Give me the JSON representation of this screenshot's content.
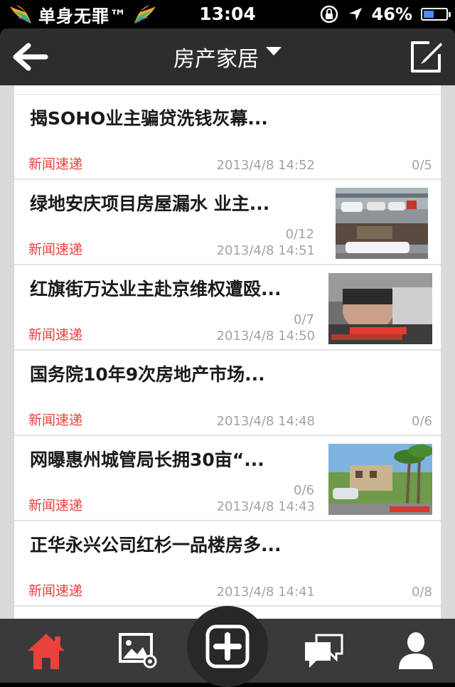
{
  "status_bar": {
    "carrier": "单身无罪™",
    "time": "13:04",
    "battery_percent": "46%",
    "battery_level": 0.46
  },
  "nav": {
    "title": "房产家居",
    "back_icon": "arrow-left-icon",
    "dropdown_icon": "triangle-down-icon",
    "compose_icon": "compose-icon"
  },
  "news": [
    {
      "title": "揭SOHO业主骗贷洗钱灰幕...",
      "category": "新闻速递",
      "time": "2013/4/8 14:52",
      "count": "0/5",
      "has_image": false
    },
    {
      "title": "绿地安庆项目房屋漏水 业主...",
      "category": "新闻速递",
      "time": "2013/4/8 14:51",
      "count": "0/12",
      "has_image": true
    },
    {
      "title": "红旗街万达业主赴京维权遭殴...",
      "category": "新闻速递",
      "time": "2013/4/8 14:50",
      "count": "0/7",
      "has_image": true
    },
    {
      "title": "国务院10年9次房地产市场...",
      "category": "新闻速递",
      "time": "2013/4/8 14:48",
      "count": "0/6",
      "has_image": false
    },
    {
      "title": "网曝惠州城管局长拥30亩“...",
      "category": "新闻速递",
      "time": "2013/4/8 14:43",
      "count": "0/6",
      "has_image": true
    },
    {
      "title": "正华永兴公司红杉一品楼房多...",
      "category": "新闻速递",
      "time": "2013/4/8 14:41",
      "count": "0/8",
      "has_image": false
    }
  ],
  "tabs": [
    {
      "icon": "home-icon",
      "active": true
    },
    {
      "icon": "photo-gallery-icon",
      "active": false
    },
    {
      "icon": "add-icon",
      "active": false
    },
    {
      "icon": "chat-icon",
      "active": false
    },
    {
      "icon": "user-icon",
      "active": false
    }
  ],
  "colors": {
    "accent_red": "#e8423b",
    "navbar_bg": "#2d2d2d",
    "tabbar_bg": "#3a3a3a"
  }
}
